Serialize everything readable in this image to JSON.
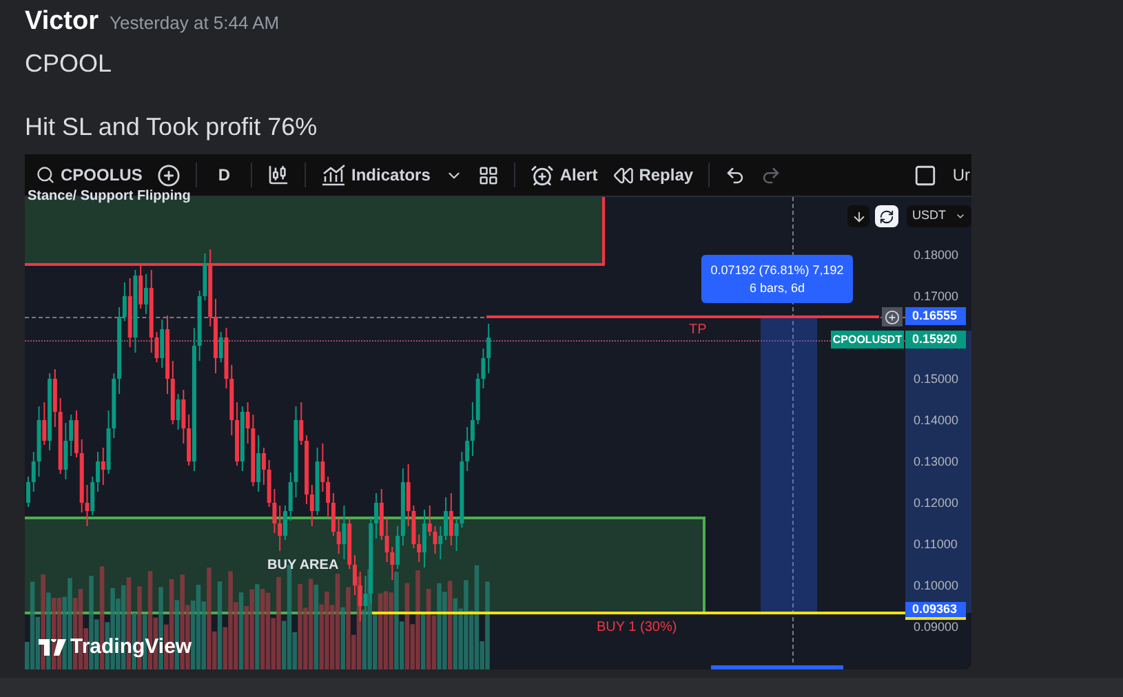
{
  "message": {
    "author": "Victor",
    "timestamp": "Yesterday at 5:44 AM",
    "lines": [
      "CPOOL",
      "Hit SL and Took profit 76%"
    ]
  },
  "toolbar": {
    "symbol": "CPOOLUS",
    "interval": "D",
    "indicators": "Indicators",
    "alert": "Alert",
    "replay": "Replay",
    "cut_label": "Ur"
  },
  "chart": {
    "zone_label": "Stance/ Support Flipping",
    "buy_area": "BUY AREA",
    "tp_label": "TP",
    "buy1_label": "BUY 1 (30%)",
    "measure": {
      "line1": "0.07192 (76.81%) 7,192",
      "line2": "6 bars, 6d"
    },
    "currency": "USDT",
    "price_ticks": [
      "0.18000",
      "0.17000",
      "0.15000",
      "0.14000",
      "0.13000",
      "0.12000",
      "0.11000",
      "0.10000",
      "0.09000"
    ],
    "price_tags": [
      {
        "kind": "position",
        "value": "0.16555"
      },
      {
        "kind": "symbol",
        "symbol": "CPOOLUSDT",
        "value": "0.15920"
      },
      {
        "kind": "entry",
        "value": "0.09363"
      }
    ],
    "logo": "TradingView"
  }
}
